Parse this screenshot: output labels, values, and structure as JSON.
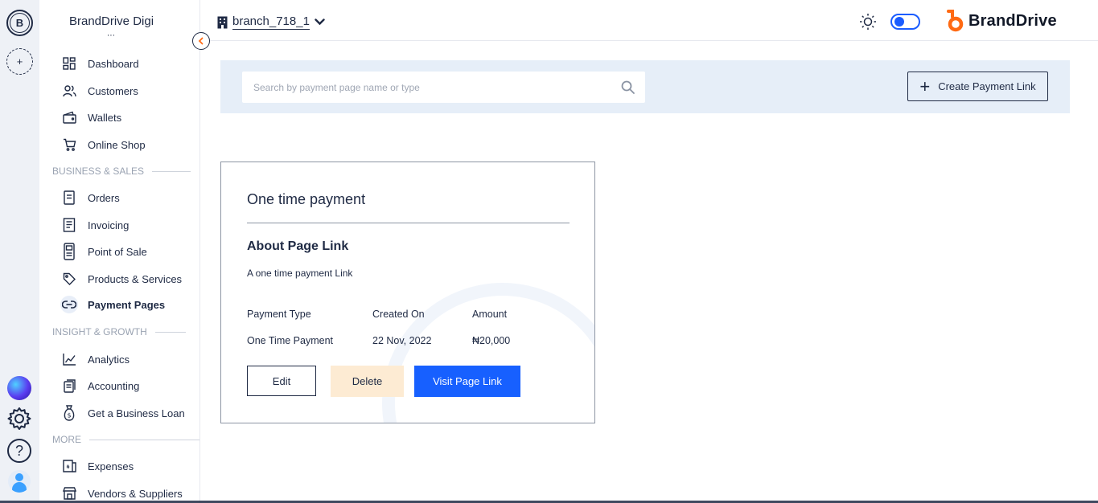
{
  "rail": {
    "workspace_initial": "B",
    "add_workspace_symbol": "+",
    "help_symbol": "?"
  },
  "sidebar": {
    "business_name": "BrandDrive Digi",
    "business_dots": "⋯",
    "items_top": [
      {
        "label": "Dashboard",
        "icon": "dashboard-icon"
      },
      {
        "label": "Customers",
        "icon": "customers-icon"
      },
      {
        "label": "Wallets",
        "icon": "wallet-icon"
      },
      {
        "label": "Online Shop",
        "icon": "cart-icon"
      }
    ],
    "section_business": "BUSINESS & SALES",
    "items_business": [
      {
        "label": "Orders",
        "icon": "orders-icon"
      },
      {
        "label": "Invoicing",
        "icon": "invoice-icon"
      },
      {
        "label": "Point of Sale",
        "icon": "pos-icon"
      },
      {
        "label": "Products & Services",
        "icon": "tag-icon"
      },
      {
        "label": "Payment Pages",
        "icon": "link-icon",
        "active": true
      }
    ],
    "section_insight": "INSIGHT & GROWTH",
    "items_insight": [
      {
        "label": "Analytics",
        "icon": "analytics-icon"
      },
      {
        "label": "Accounting",
        "icon": "accounting-icon"
      },
      {
        "label": "Get a Business Loan",
        "icon": "money-bag-icon"
      }
    ],
    "section_more": "MORE",
    "items_more": [
      {
        "label": "Expenses",
        "icon": "expenses-icon"
      },
      {
        "label": "Vendors & Suppliers",
        "icon": "store-icon"
      }
    ]
  },
  "topbar": {
    "branch_name": "branch_718_1",
    "logo_text": "BrandDrive"
  },
  "search": {
    "placeholder": "Search by payment page name or type",
    "value": ""
  },
  "create_button_label": "Create Payment Link",
  "card": {
    "title": "One time payment",
    "about_heading": "About Page Link",
    "about_description": "A one time payment Link",
    "columns": [
      "Payment Type",
      "Created On",
      "Amount"
    ],
    "values": [
      "One Time Payment",
      "22 Nov, 2022",
      "₦20,000"
    ],
    "edit_label": "Edit",
    "delete_label": "Delete",
    "visit_label": "Visit Page Link"
  },
  "colors": {
    "primary": "#1760ff",
    "text": "#1f2a44",
    "search_band": "#e6eef8",
    "delete_bg": "#fdebd3",
    "logo_orange": "#ff6a13"
  }
}
